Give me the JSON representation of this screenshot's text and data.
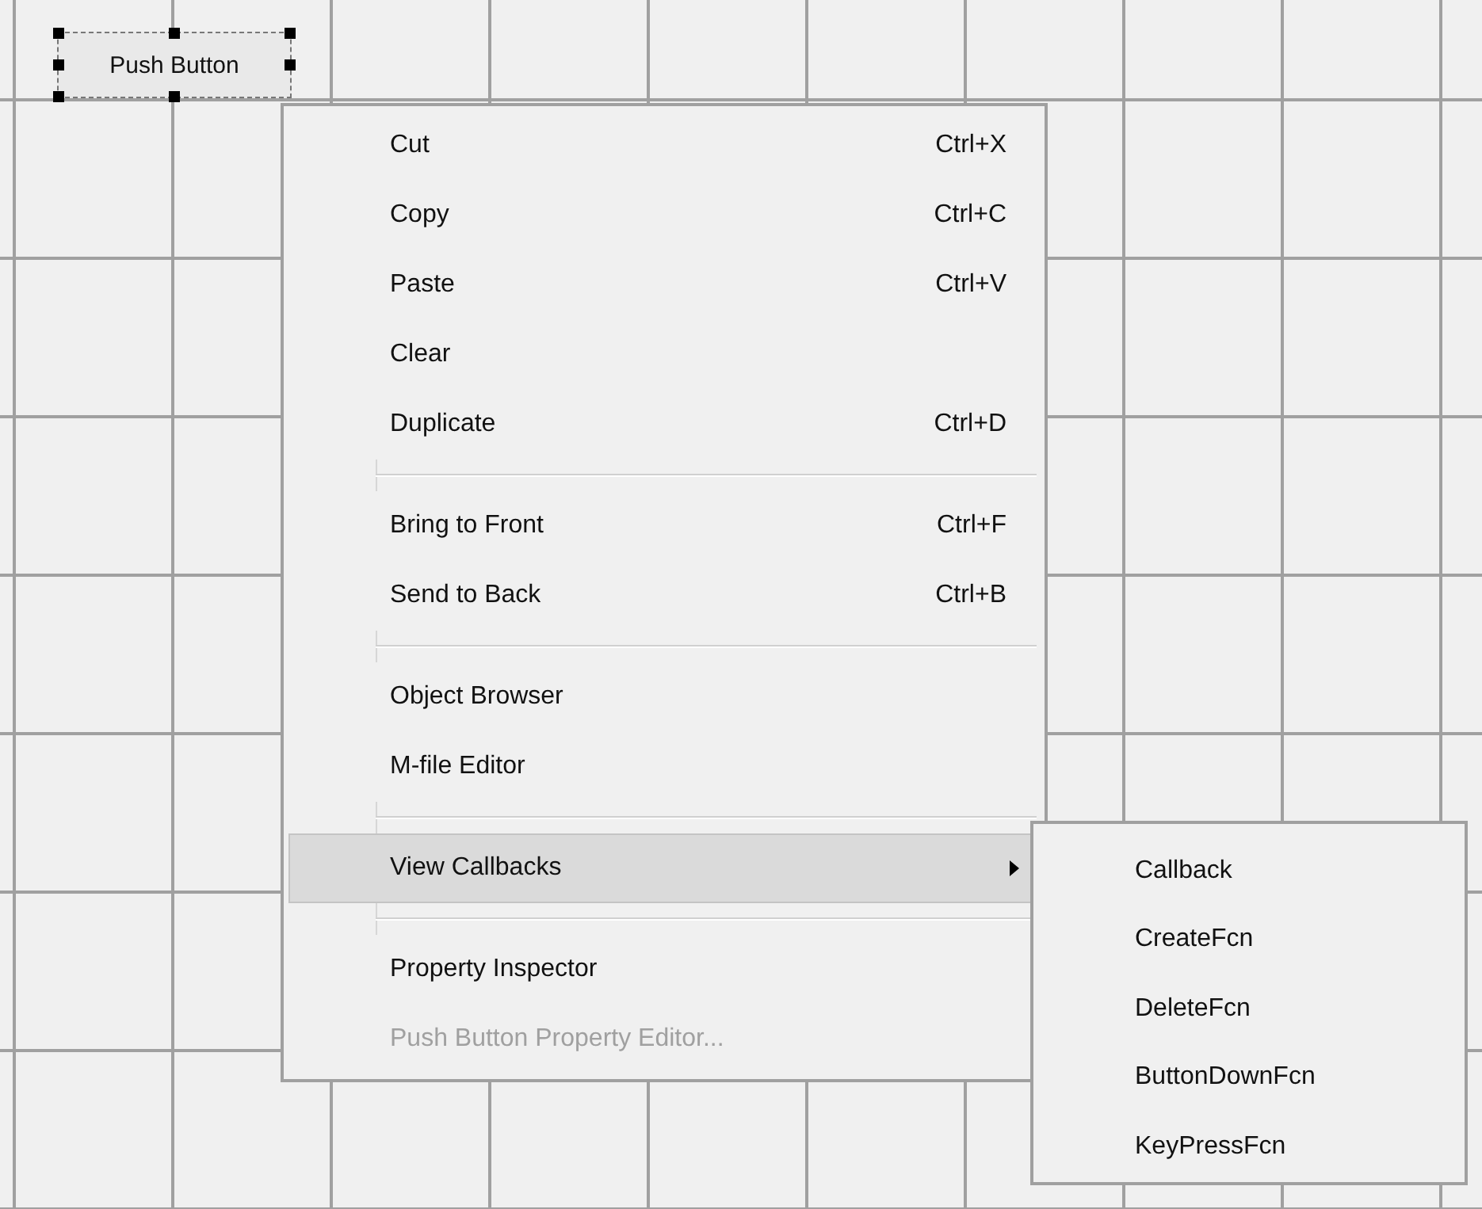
{
  "canvas": {
    "button": {
      "label": "Push Button",
      "selected": true
    }
  },
  "context_menu": {
    "items": [
      {
        "kind": "item",
        "label": "Cut",
        "shortcut": "Ctrl+X",
        "disabled": false,
        "highlighted": false,
        "has_submenu": false
      },
      {
        "kind": "item",
        "label": "Copy",
        "shortcut": "Ctrl+C",
        "disabled": false,
        "highlighted": false,
        "has_submenu": false
      },
      {
        "kind": "item",
        "label": "Paste",
        "shortcut": "Ctrl+V",
        "disabled": false,
        "highlighted": false,
        "has_submenu": false
      },
      {
        "kind": "item",
        "label": "Clear",
        "disabled": false,
        "highlighted": false,
        "has_submenu": false
      },
      {
        "kind": "item",
        "label": "Duplicate",
        "shortcut": "Ctrl+D",
        "disabled": false,
        "highlighted": false,
        "has_submenu": false
      },
      {
        "kind": "separator"
      },
      {
        "kind": "item",
        "label": "Bring to Front",
        "shortcut": "Ctrl+F",
        "disabled": false,
        "highlighted": false,
        "has_submenu": false
      },
      {
        "kind": "item",
        "label": "Send to Back",
        "shortcut": "Ctrl+B",
        "disabled": false,
        "highlighted": false,
        "has_submenu": false
      },
      {
        "kind": "separator"
      },
      {
        "kind": "item",
        "label": "Object Browser",
        "disabled": false,
        "highlighted": false,
        "has_submenu": false
      },
      {
        "kind": "item",
        "label": "M-file Editor",
        "disabled": false,
        "highlighted": false,
        "has_submenu": false
      },
      {
        "kind": "separator"
      },
      {
        "kind": "item",
        "label": "View Callbacks",
        "disabled": false,
        "highlighted": true,
        "has_submenu": true
      },
      {
        "kind": "separator"
      },
      {
        "kind": "item",
        "label": "Property Inspector",
        "disabled": false,
        "highlighted": false,
        "has_submenu": false
      },
      {
        "kind": "item",
        "label": "Push Button Property Editor...",
        "disabled": true,
        "highlighted": false,
        "has_submenu": false
      }
    ]
  },
  "submenu": {
    "items": [
      {
        "label": "Callback"
      },
      {
        "label": "CreateFcn"
      },
      {
        "label": "DeleteFcn"
      },
      {
        "label": "ButtonDownFcn"
      },
      {
        "label": "KeyPressFcn"
      }
    ]
  }
}
